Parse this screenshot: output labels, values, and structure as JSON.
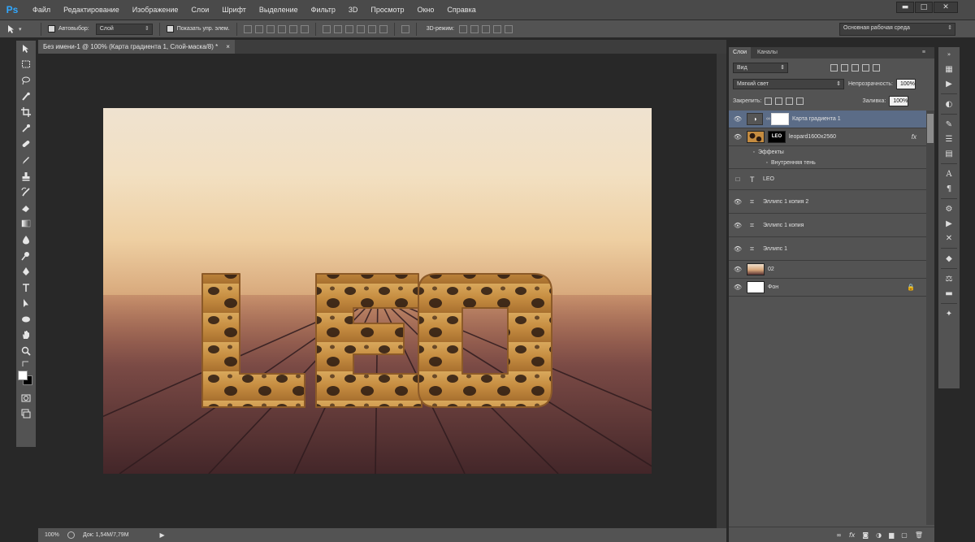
{
  "app": {
    "logo": "Ps"
  },
  "menu": [
    "Файл",
    "Редактирование",
    "Изображение",
    "Слои",
    "Шрифт",
    "Выделение",
    "Фильтр",
    "3D",
    "Просмотр",
    "Окно",
    "Справка"
  ],
  "window_controls": {
    "minimize": "▬",
    "maximize": "□",
    "close": "✕"
  },
  "options_bar": {
    "autoselect_label": "Автовыбор:",
    "autoselect_value": "Слой",
    "show_transform_label": "Показать упр. элем.",
    "mode_3d_label": "3D-режим:",
    "workspace": "Основная рабочая среда"
  },
  "document": {
    "tab_title": "Без имени-1 @ 100% (Карта градиента 1, Слой-маска/8) *",
    "tab_close": "×",
    "zoom": "100%",
    "doc_size": "Док: 1,54M/7,79M",
    "canvas_text": "LEO",
    "colors": {
      "sky_top": "#efe2d0",
      "sky_warm": "#eecfa2",
      "floor_dark": "#4c2b2f",
      "fur": "#c99447"
    }
  },
  "tools": [
    "move-tool-icon",
    "marquee-tool-icon",
    "lasso-tool-icon",
    "quick-selection-icon",
    "crop-tool-icon",
    "eyedropper-icon",
    "healing-brush-icon",
    "brush-tool-icon",
    "clone-stamp-icon",
    "history-brush-icon",
    "eraser-icon",
    "gradient-tool-icon",
    "blur-tool-icon",
    "dodge-tool-icon",
    "pen-tool-icon",
    "type-tool-icon",
    "path-selection-icon",
    "ellipse-tool-icon",
    "hand-tool-icon",
    "zoom-tool-icon"
  ],
  "layers_panel": {
    "tabs": [
      "Слои",
      "Каналы"
    ],
    "filter_kind": "Вид",
    "blend_mode": "Мягкий свет",
    "opacity_label": "Непрозрачность:",
    "opacity": "100%",
    "lock_label": "Закрепить:",
    "fill_label": "Заливка:",
    "fill": "100%",
    "layers": [
      {
        "name": "Карта градиента 1",
        "selected": true
      },
      {
        "name": "leopard1600x2560",
        "mask_text": "LEO",
        "fx": "fx"
      },
      {
        "name": "Эффекты"
      },
      {
        "name": "Внутренняя тень"
      },
      {
        "name": "LEO",
        "type_glyph": "T"
      },
      {
        "name": "Эллипс 1 копия 2"
      },
      {
        "name": "Эллипс 1 копия"
      },
      {
        "name": "Эллипс 1"
      },
      {
        "name": "02"
      },
      {
        "name": "Фон"
      }
    ],
    "footer_icons": [
      "link-icon",
      "fx-icon",
      "mask-icon",
      "adjustment-icon",
      "group-icon",
      "new-layer-icon",
      "trash-icon"
    ],
    "footer_fx": "fx"
  }
}
